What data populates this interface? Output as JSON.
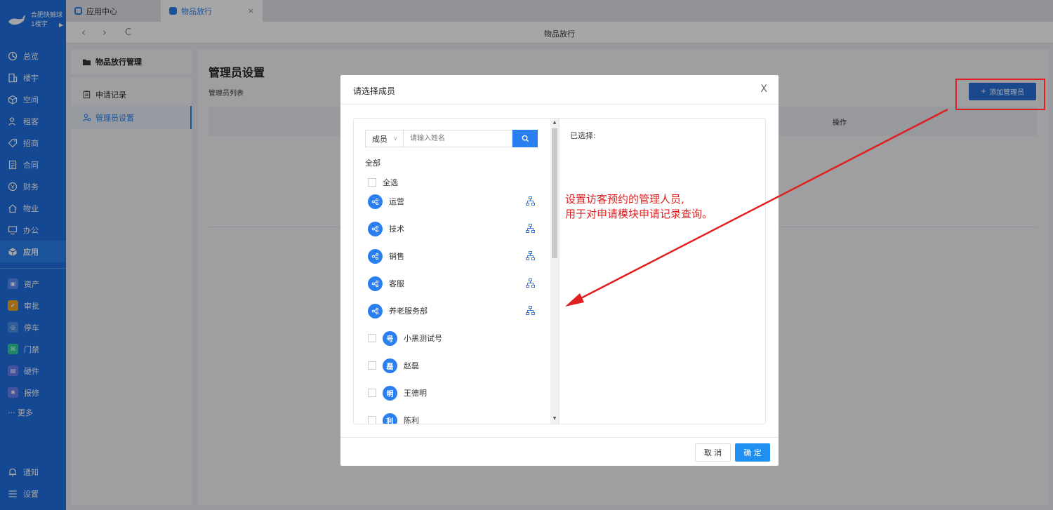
{
  "sidebar": {
    "org_name": "合肥快鲸球",
    "building": "1楼宇",
    "items": [
      {
        "label": "总览",
        "icon": "dashboard-icon"
      },
      {
        "label": "楼宇",
        "icon": "building-icon"
      },
      {
        "label": "空间",
        "icon": "cube-icon"
      },
      {
        "label": "租客",
        "icon": "users-icon"
      },
      {
        "label": "招商",
        "icon": "tag-icon"
      },
      {
        "label": "合同",
        "icon": "document-icon"
      },
      {
        "label": "财务",
        "icon": "money-icon"
      },
      {
        "label": "物业",
        "icon": "home-icon"
      },
      {
        "label": "办公",
        "icon": "monitor-icon"
      },
      {
        "label": "应用",
        "icon": "app-cube-icon"
      }
    ],
    "apps": [
      {
        "label": "资产",
        "color": "#5b8df7"
      },
      {
        "label": "审批",
        "color": "#f5a623"
      },
      {
        "label": "停车",
        "color": "#4a90e2"
      },
      {
        "label": "门禁",
        "color": "#2ecf9c"
      },
      {
        "label": "硬件",
        "color": "#6c7ef5"
      },
      {
        "label": "报修",
        "color": "#6c7ef5"
      }
    ],
    "more": "··· 更多",
    "bottom": [
      {
        "label": "通知",
        "icon": "bell-icon"
      },
      {
        "label": "设置",
        "icon": "menu-icon"
      }
    ]
  },
  "tabs": [
    {
      "label": "应用中心"
    },
    {
      "label": "物品放行",
      "close": "×"
    }
  ],
  "nav": {
    "title": "物品放行",
    "back": "‹",
    "forward": "›",
    "refresh": "C"
  },
  "left_panel": {
    "title": "物品放行管理",
    "items": [
      {
        "label": "申请记录"
      },
      {
        "label": "管理员设置"
      }
    ]
  },
  "main": {
    "title": "管理员设置",
    "subtitle": "管理员列表",
    "add_button": "添加管理员",
    "add_plus": "+",
    "column_op": "操作"
  },
  "modal": {
    "title": "请选择成员",
    "close": "X",
    "search_type": "成员",
    "search_caret": "∨",
    "search_placeholder": "请输入姓名",
    "all_label": "全部",
    "select_all": "全选",
    "selected_label": "已选择:",
    "departments": [
      "运营",
      "技术",
      "销售",
      "客服",
      "养老服务部"
    ],
    "members": [
      {
        "avatar": "号",
        "name": "小黑测试号"
      },
      {
        "avatar": "磊",
        "name": "赵磊"
      },
      {
        "avatar": "明",
        "name": "王德明"
      },
      {
        "avatar": "利",
        "name": "陈利"
      }
    ],
    "cancel": "取 消",
    "confirm": "确 定"
  },
  "annotation": {
    "line1": "设置访客预约的管理人员,",
    "line2": "用于对申请模块申请记录查询。",
    "color": "#e02020"
  },
  "colors": {
    "primary": "#1f6fe0",
    "accent": "#2a7ff0"
  }
}
